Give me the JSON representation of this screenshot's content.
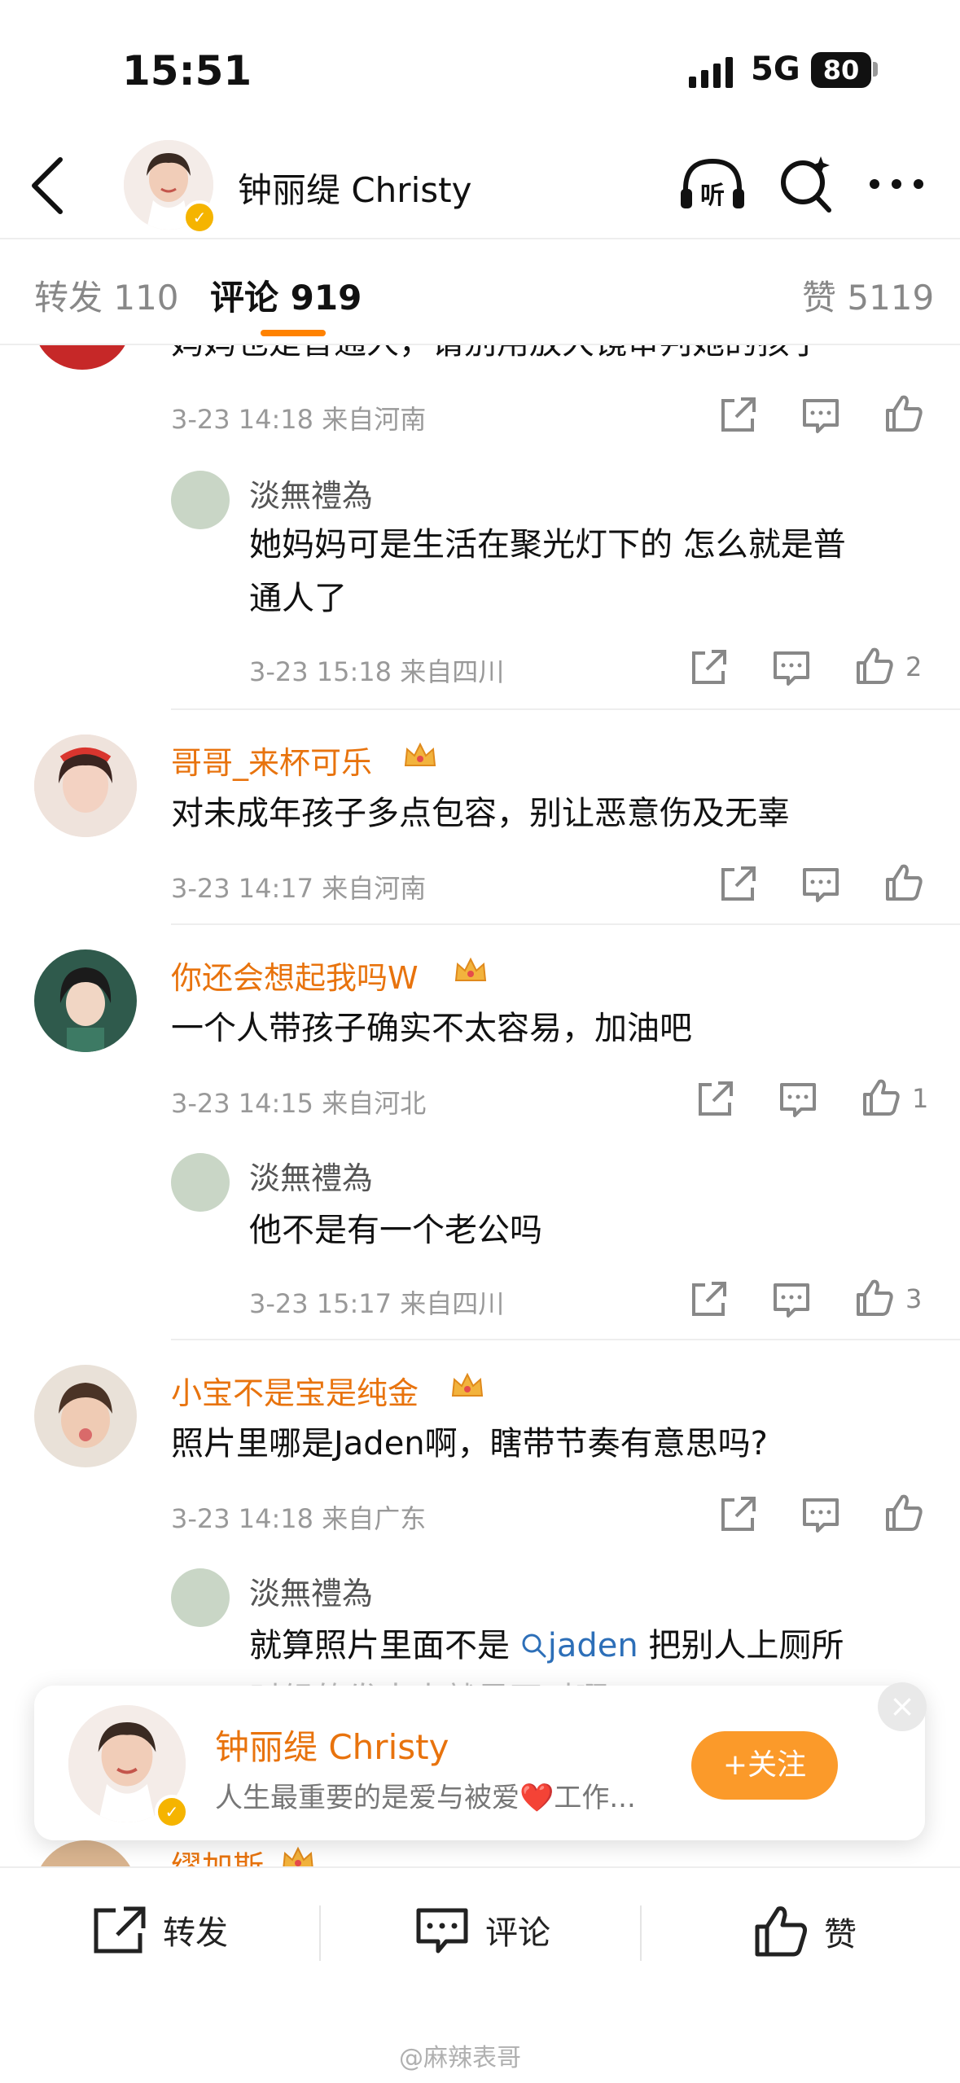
{
  "status_bar": {
    "time": "15:51",
    "network": "5G",
    "battery": "80"
  },
  "nav": {
    "title": "钟丽缇 Christy",
    "listen_label": "听"
  },
  "tabs": {
    "repost": "转发 110",
    "comments": "评论 919",
    "likes": "赞 5119"
  },
  "comments": [
    {
      "text": "妈妈也是普通人，请别用放大镜审判她的孩子",
      "meta": "3-23 14:18 来自河南",
      "likes": "",
      "replies": [
        {
          "user": "淡無禮為",
          "text_line1": "她妈妈可是生活在聚光灯下的 怎么就是普",
          "text_line2": "通人了",
          "meta": "3-23 15:18 来自四川",
          "likes": "2"
        }
      ]
    },
    {
      "user": "哥哥_来杯可乐",
      "text": "对未成年孩子多点包容，别让恶意伤及无辜",
      "meta": "3-23 14:17 来自河南",
      "likes": ""
    },
    {
      "user": "你还会想起我吗W",
      "text": "一个人带孩子确实不太容易，加油吧",
      "meta": "3-23 14:15 来自河北",
      "likes": "1",
      "replies": [
        {
          "user": "淡無禮為",
          "text_line1": "他不是有一个老公吗",
          "meta": "3-23 15:17 来自四川",
          "likes": "3"
        }
      ]
    },
    {
      "user": "小宝不是宝是纯金",
      "text": "照片里哪是Jaden啊，瞎带节奏有意思吗?",
      "meta": "3-23 14:18 来自广东",
      "likes": "",
      "replies": [
        {
          "user": "淡無禮為",
          "text_before": "就算照片里面不是",
          "mention": "jaden",
          "text_after": "把别人上厕所",
          "text_line2": "时候的发出来就是不对啊"
        }
      ]
    },
    {
      "user": "缪加斯"
    }
  ],
  "follow_card": {
    "name": "钟丽缇 Christy",
    "desc": "人生最重要的是爱与被爱❤️工作...",
    "follow_label": "+关注",
    "close": "×"
  },
  "bottom_bar": {
    "repost": "转发",
    "comment": "评论",
    "like": "赞"
  },
  "watermark": "@麻辣表哥",
  "colors": {
    "accent": "#ff8200",
    "username": "#e8730d",
    "follow_button": "#fb9a2a",
    "verified": "#f5b400"
  },
  "icons": [
    "back-icon",
    "listen-icon",
    "search-icon",
    "more-icon",
    "share-icon",
    "comment-icon",
    "like-icon",
    "crown-icon",
    "verified-icon"
  ]
}
